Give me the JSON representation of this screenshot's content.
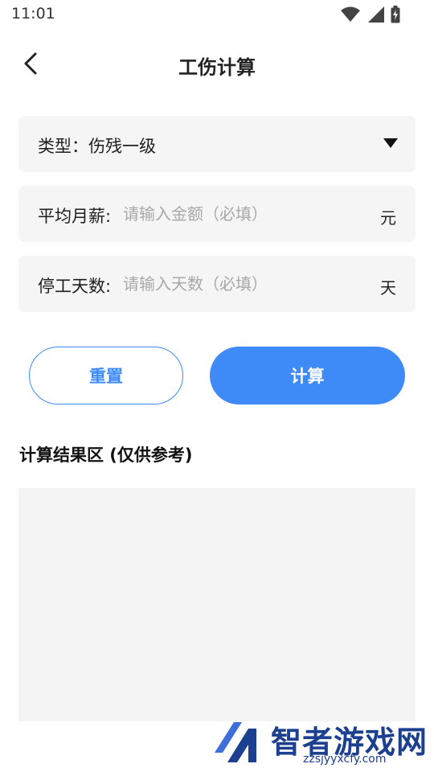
{
  "status_bar": {
    "time": "11:01",
    "icons": [
      "wifi-icon",
      "signal-icon",
      "battery-charging-icon"
    ]
  },
  "header": {
    "title": "工伤计算",
    "back_icon": "chevron-left-icon"
  },
  "form": {
    "type": {
      "label": "类型：",
      "value": "伤残一级",
      "icon": "caret-down-icon"
    },
    "salary": {
      "label": "平均月薪:",
      "placeholder": "请输入金额（必填）",
      "value": "",
      "unit": "元"
    },
    "days": {
      "label": "停工天数:",
      "placeholder": "请输入天数（必填）",
      "value": "",
      "unit": "天"
    }
  },
  "actions": {
    "reset_label": "重置",
    "calculate_label": "计算"
  },
  "result": {
    "title": "计算结果区 (仅供参考)",
    "content": ""
  },
  "watermark": {
    "brand": "智者游戏网",
    "url": "zzsjyyxcfy.com"
  },
  "colors": {
    "accent": "#3e8bf7",
    "field_bg": "#f5f5f5",
    "placeholder": "#a8a8a8",
    "watermark": "#1c3f8f"
  }
}
